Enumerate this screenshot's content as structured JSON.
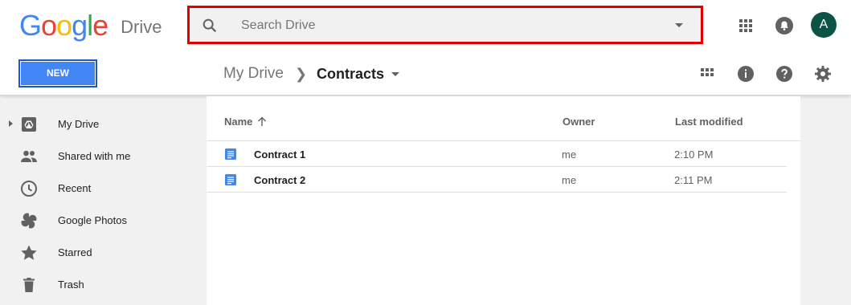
{
  "header": {
    "logo_text": "Google",
    "logo_letters": [
      {
        "ch": "G",
        "color": "#4285F4"
      },
      {
        "ch": "o",
        "color": "#EA4335"
      },
      {
        "ch": "o",
        "color": "#FBBC05"
      },
      {
        "ch": "g",
        "color": "#4285F4"
      },
      {
        "ch": "l",
        "color": "#34A853"
      },
      {
        "ch": "e",
        "color": "#EA4335"
      }
    ],
    "product_name": "Drive",
    "avatar_letter": "A",
    "avatar_color": "#0b5345"
  },
  "search": {
    "placeholder": "Search Drive",
    "highlight_color": "#e00000"
  },
  "toolbar": {
    "new_label": "NEW",
    "new_color": "#4285f4",
    "breadcrumb_root": "My Drive",
    "breadcrumb_current": "Contracts"
  },
  "sidebar": {
    "items": [
      {
        "label": "My Drive",
        "icon": "my-drive-icon"
      },
      {
        "label": "Shared with me",
        "icon": "people-icon"
      },
      {
        "label": "Recent",
        "icon": "clock-icon"
      },
      {
        "label": "Google Photos",
        "icon": "pinwheel-icon"
      },
      {
        "label": "Starred",
        "icon": "star-icon"
      },
      {
        "label": "Trash",
        "icon": "trash-icon"
      }
    ]
  },
  "files": {
    "columns": {
      "name": "Name",
      "owner": "Owner",
      "modified": "Last modified"
    },
    "rows": [
      {
        "name": "Contract 1",
        "owner": "me",
        "modified": "2:10 PM",
        "icon": "docs-icon"
      },
      {
        "name": "Contract 2",
        "owner": "me",
        "modified": "2:11 PM",
        "icon": "docs-icon"
      }
    ]
  }
}
